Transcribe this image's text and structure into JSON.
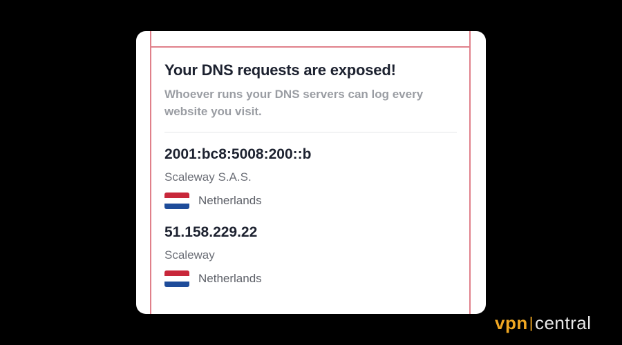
{
  "card": {
    "title": "Your DNS requests are exposed!",
    "subtitle": "Whoever runs your DNS servers can log every website you visit."
  },
  "servers": [
    {
      "ip": "2001:bc8:5008:200::b",
      "isp": "Scaleway S.A.S.",
      "country": "Netherlands",
      "flag": "netherlands-flag"
    },
    {
      "ip": "51.158.229.22",
      "isp": "Scaleway",
      "country": "Netherlands",
      "flag": "netherlands-flag"
    }
  ],
  "watermark": {
    "part1": "vpn",
    "separator": "|",
    "part2": "central"
  },
  "colors": {
    "background": "#000000",
    "card": "#ffffff",
    "frame": "#e0808a",
    "title": "#1d2230",
    "subtitle": "#9a9da3",
    "brand_accent": "#f0a722"
  }
}
